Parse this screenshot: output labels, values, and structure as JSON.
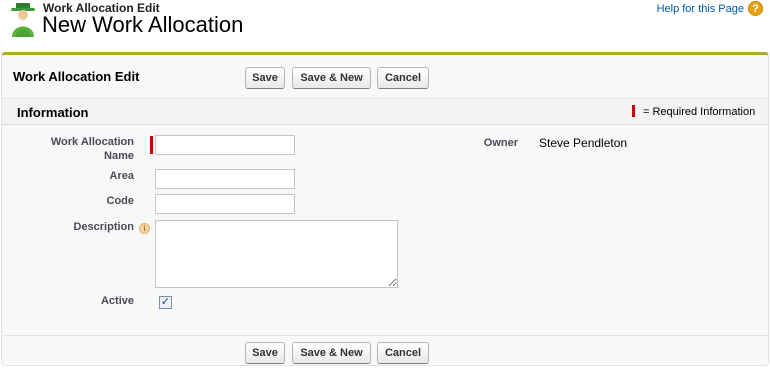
{
  "header": {
    "breadcrumb": "Work Allocation Edit",
    "title": "New Work Allocation",
    "help_link": "Help for this Page",
    "help_icon_glyph": "?"
  },
  "panel": {
    "title": "Work Allocation Edit",
    "buttons": {
      "save": "Save",
      "save_new": "Save & New",
      "cancel": "Cancel"
    }
  },
  "section": {
    "title": "Information",
    "required_legend": "= Required Information"
  },
  "form": {
    "work_allocation_name_label_line1": "Work Allocation",
    "work_allocation_name_label_line2": "Name",
    "work_allocation_name_value": "",
    "area_label": "Area",
    "area_value": "",
    "code_label": "Code",
    "code_value": "",
    "description_label": "Description",
    "description_value": "",
    "active_label": "Active",
    "active_checked": true,
    "owner_label": "Owner",
    "owner_value": "Steve Pendleton"
  },
  "colors": {
    "accent_border": "#a6b02d",
    "required": "#cc0000",
    "link": "#015ba7"
  }
}
